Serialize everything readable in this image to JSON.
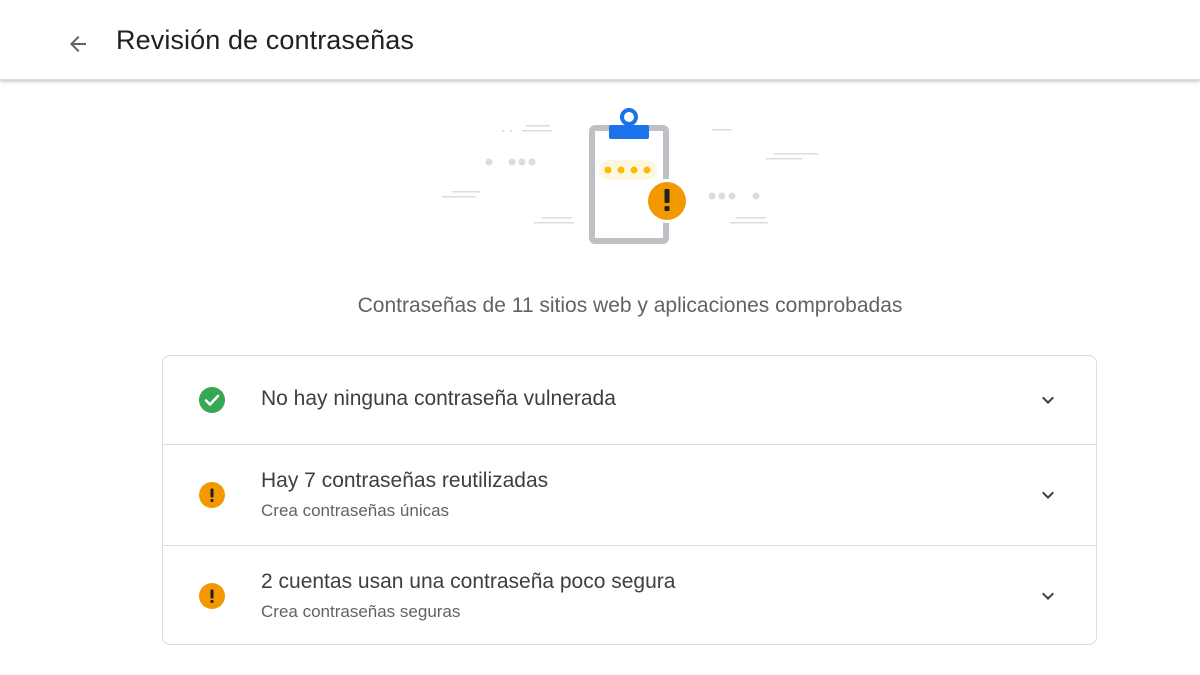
{
  "header": {
    "title": "Revisión de contraseñas",
    "back_icon": "arrow-back-icon"
  },
  "illustration": {
    "icon": "clipboard-warning-illustration"
  },
  "summary": "Contraseñas de 11 sitios web y aplicaciones comprobadas",
  "checks": [
    {
      "title": "No hay ninguna contraseña vulnerada",
      "subtitle": "",
      "status": "ok",
      "icon": "check-circle-icon"
    },
    {
      "title": "Hay 7 contraseñas reutilizadas",
      "subtitle": "Crea contraseñas únicas",
      "status": "warning",
      "icon": "warning-circle-icon"
    },
    {
      "title": "2 cuentas usan una contraseña poco segura",
      "subtitle": "Crea contraseñas seguras",
      "status": "warning",
      "icon": "warning-circle-icon"
    }
  ],
  "colors": {
    "ok": "#34a853",
    "warning": "#f29900",
    "accent": "#1a73e8"
  }
}
